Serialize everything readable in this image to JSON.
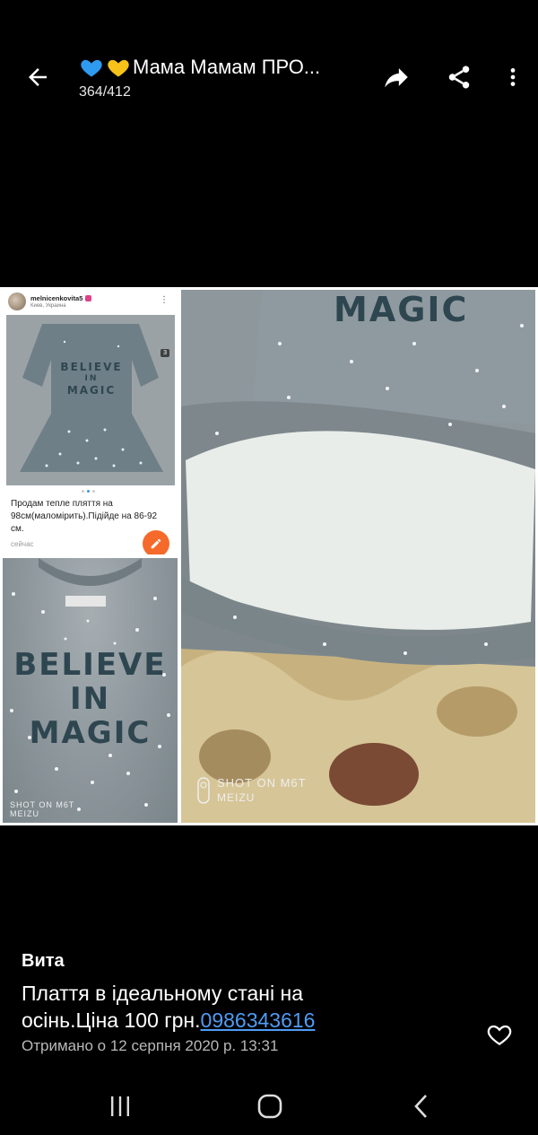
{
  "header": {
    "emoji_hearts": [
      "blue-heart",
      "yellow-heart"
    ],
    "title": "Мама Мамам ПРО...",
    "counter": "364/412"
  },
  "collage": {
    "insta_post": {
      "username": "melnicenkovita5",
      "location": "Киев, Украина",
      "photo_count": "3",
      "caption": "Продам тепле пляття на 98см(маломірить).Підійде на 86-92 см.",
      "time": "сейчас"
    },
    "shirt_print": [
      "BELIEVE",
      "IN",
      "MAGIC"
    ],
    "insta_print": [
      "BELIEVE",
      "IN",
      "MAGIC"
    ],
    "dress_print": "MAGIC",
    "watermark_line1": "SHOT ON M6T",
    "watermark_line2": "MEIZU",
    "small_watermark_line1": "SHOT ON M6T",
    "small_watermark_line2": "MEIZU"
  },
  "message": {
    "sender": "Вита",
    "text": "Плаття в ідеальному стані на осінь.Ціна 100 грн.",
    "phone": "0986343616",
    "received": "Отримано о 12 серпня 2020 р. 13:31"
  },
  "colors": {
    "background": "#000000",
    "link": "#4f9cf3",
    "secondary_text": "#b8b8b8"
  }
}
